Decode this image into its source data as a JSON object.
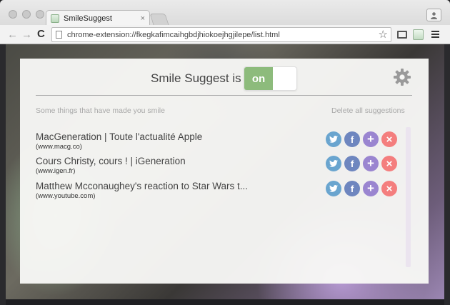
{
  "browser": {
    "tab_title": "SmileSuggest",
    "tab_close": "×",
    "url": "chrome-extension://fkegkafimcaihgbdjhiokoejhgjilepe/list.html",
    "back": "←",
    "forward": "→",
    "reload": "C",
    "star": "☆"
  },
  "header": {
    "title": "Smile Suggest is",
    "toggle_label": "on"
  },
  "list": {
    "caption": "Some things that have made you smile",
    "delete_all": "Delete all suggestions",
    "items": [
      {
        "title": "MacGeneration | Toute l'actualité Apple",
        "url": "(www.macg.co)"
      },
      {
        "title": "Cours Christy, cours ! | iGeneration",
        "url": "(www.igen.fr)"
      },
      {
        "title": "Matthew Mcconaughey's reaction to Star Wars t...",
        "url": "(www.youtube.com)"
      }
    ],
    "actions": {
      "facebook": "f",
      "add": "+",
      "delete": "×"
    }
  },
  "colors": {
    "toggle_on": "#8dbb7c",
    "twitter": "#6aa5cf",
    "facebook": "#6e86bf",
    "add": "#9a85d0",
    "delete": "#f47e7e"
  },
  "icons": [
    "twitter-icon",
    "facebook-icon",
    "add-icon",
    "delete-icon",
    "gear-icon",
    "star-icon",
    "cast-icon",
    "menu-icon",
    "profile-icon"
  ]
}
